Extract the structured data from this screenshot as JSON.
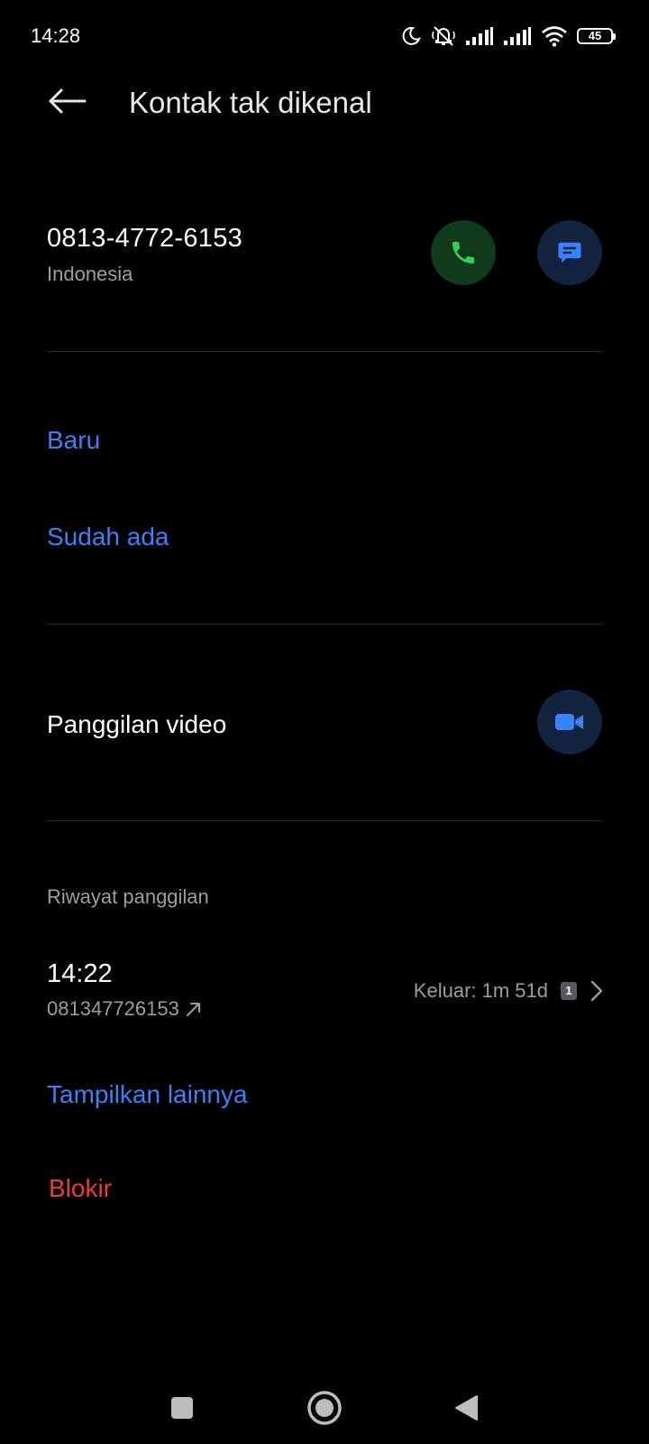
{
  "status_bar": {
    "time": "14:28",
    "battery": "45",
    "icons": [
      "moon-icon",
      "mute-icon",
      "signal-icon",
      "signal-icon",
      "wifi-icon",
      "battery-icon"
    ]
  },
  "header": {
    "title": "Kontak tak dikenal",
    "back_icon": "arrow-left-icon"
  },
  "contact": {
    "number": "0813-4772-6153",
    "region": "Indonesia",
    "call_icon": "phone-icon",
    "message_icon": "message-icon"
  },
  "add_contact": {
    "new_label": "Baru",
    "existing_label": "Sudah ada"
  },
  "video_call": {
    "label": "Panggilan video",
    "icon": "video-camera-icon"
  },
  "call_history": {
    "section_label": "Riwayat panggilan",
    "entries": [
      {
        "time": "14:22",
        "number": "081347726153",
        "direction_icon": "outgoing-arrow-icon",
        "detail": "Keluar: 1m 51d",
        "sim": "1"
      }
    ],
    "show_more_label": "Tampilkan lainnya"
  },
  "block_label": "Blokir",
  "colors": {
    "accent_blue": "#3b82f6",
    "danger_red": "#ef3a3a",
    "call_green": "#2fd15a",
    "background": "#000000"
  },
  "nav_bar": {
    "icons": [
      "recents-square-icon",
      "home-circle-icon",
      "back-triangle-icon"
    ]
  }
}
